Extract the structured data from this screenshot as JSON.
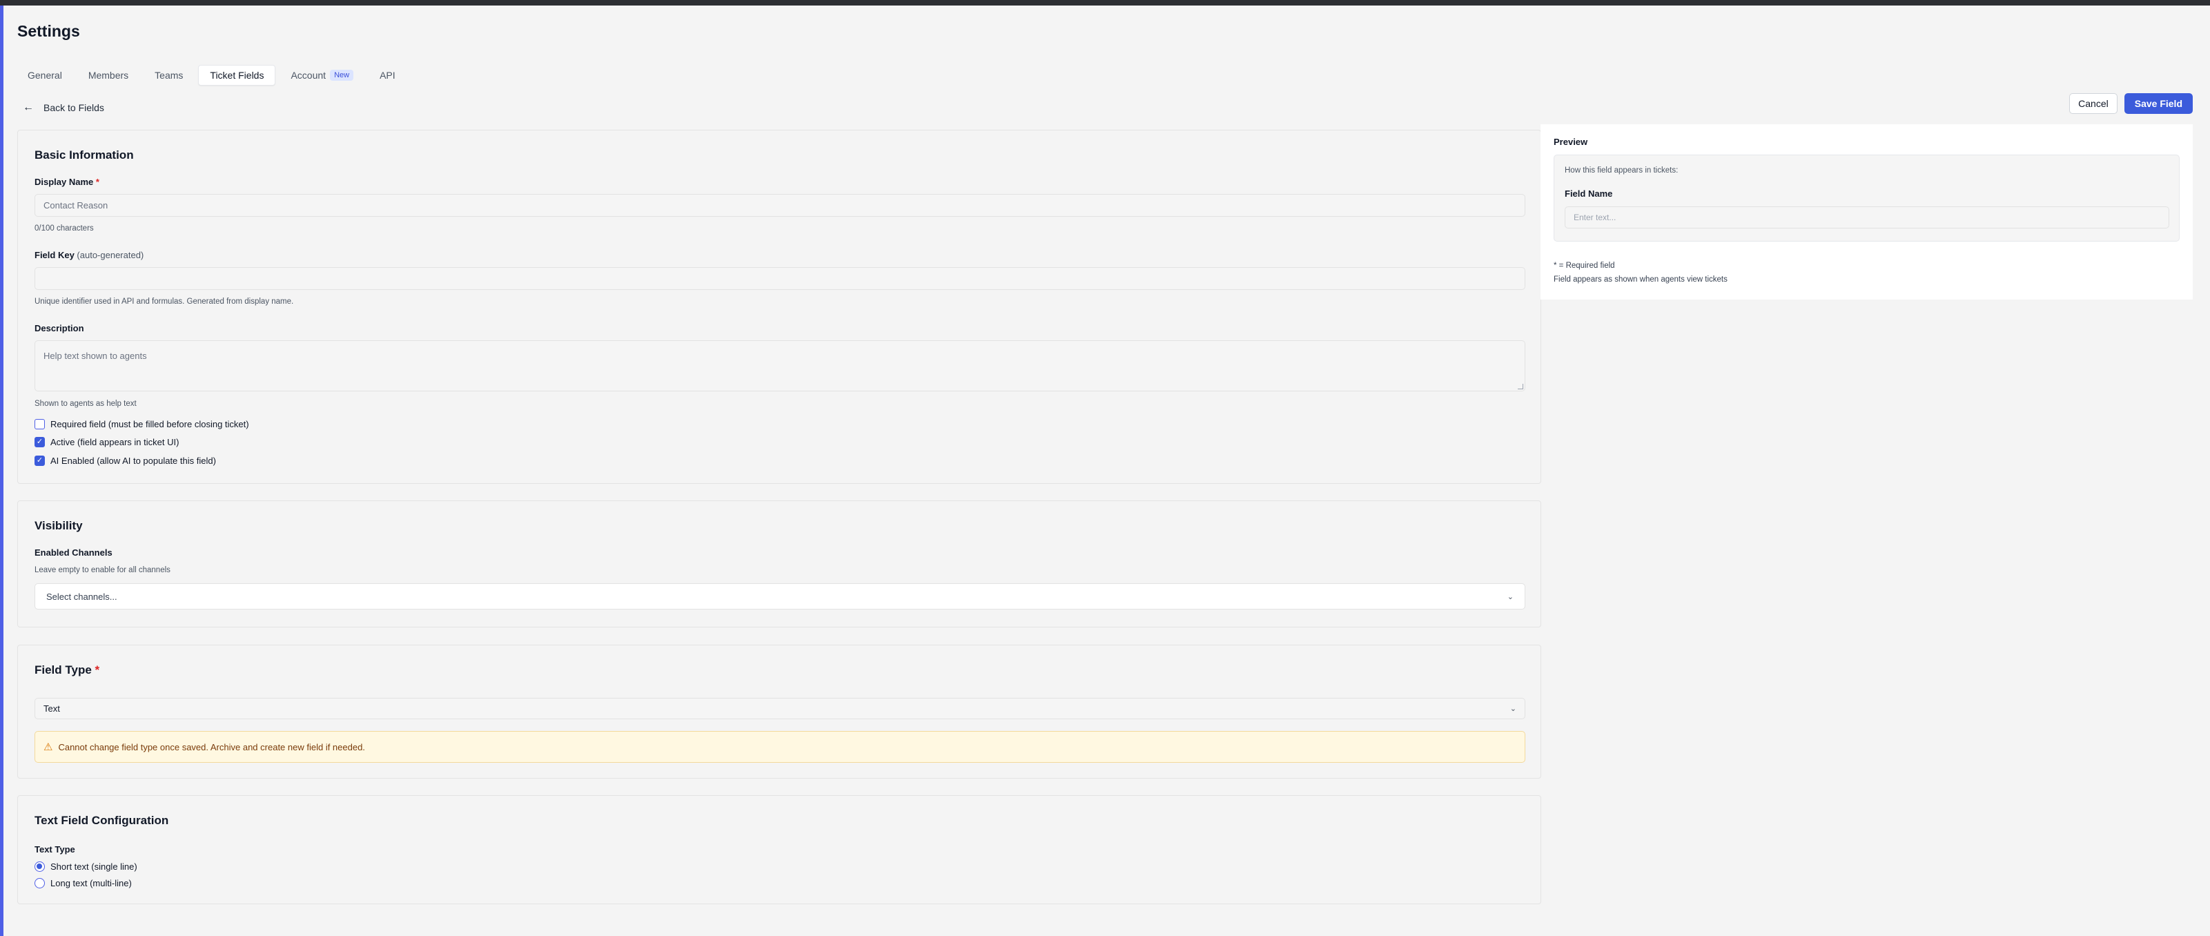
{
  "page": {
    "title": "Settings"
  },
  "tabs": [
    {
      "label": "General"
    },
    {
      "label": "Members"
    },
    {
      "label": "Teams"
    },
    {
      "label": "Ticket Fields",
      "active": true
    },
    {
      "label": "Account",
      "badge": "New"
    },
    {
      "label": "API"
    }
  ],
  "nav": {
    "back_label": "Back to Fields",
    "back_icon": "arrow-left-icon"
  },
  "actions": {
    "cancel_label": "Cancel",
    "save_label": "Save Field"
  },
  "basic_info": {
    "title": "Basic Information",
    "display_name": {
      "label": "Display Name",
      "required_mark": "*",
      "placeholder": "Contact Reason",
      "value": "",
      "char_count": "0/100 characters"
    },
    "field_key": {
      "label": "Field Key",
      "label_suffix": "(auto-generated)",
      "value": "",
      "hint": "Unique identifier used in API and formulas. Generated from display name."
    },
    "description": {
      "label": "Description",
      "placeholder": "Help text shown to agents",
      "hint": "Shown to agents as help text"
    },
    "options": [
      {
        "label": "Required field (must be filled before closing ticket)",
        "checked": false
      },
      {
        "label": "Active (field appears in ticket UI)",
        "checked": true
      },
      {
        "label": "AI Enabled (allow AI to populate this field)",
        "checked": true
      }
    ]
  },
  "visibility": {
    "title": "Visibility",
    "channels_label": "Enabled Channels",
    "channels_hint": "Leave empty to enable for all channels",
    "channels_placeholder": "Select channels..."
  },
  "field_type": {
    "title": "Field Type",
    "required_mark": "*",
    "selected": "Text",
    "warning": "Cannot change field type once saved. Archive and create new field if needed.",
    "warning_icon": "warning-icon"
  },
  "text_config": {
    "title": "Text Field Configuration",
    "type_label": "Text Type",
    "options": [
      {
        "label": "Short text (single line)",
        "selected": true
      },
      {
        "label": "Long text (multi-line)",
        "selected": false
      }
    ]
  },
  "preview": {
    "title": "Preview",
    "subtitle": "How this field appears in tickets:",
    "field_name": "Field Name",
    "input_placeholder": "Enter text...",
    "note_required": "* = Required field",
    "note_view": "Field appears as shown when agents view tickets"
  },
  "colors": {
    "accent": "#3b5bdb",
    "required": "#dc2626",
    "warning_bg": "#fff8e1",
    "warning_text": "#7a3b0a"
  }
}
